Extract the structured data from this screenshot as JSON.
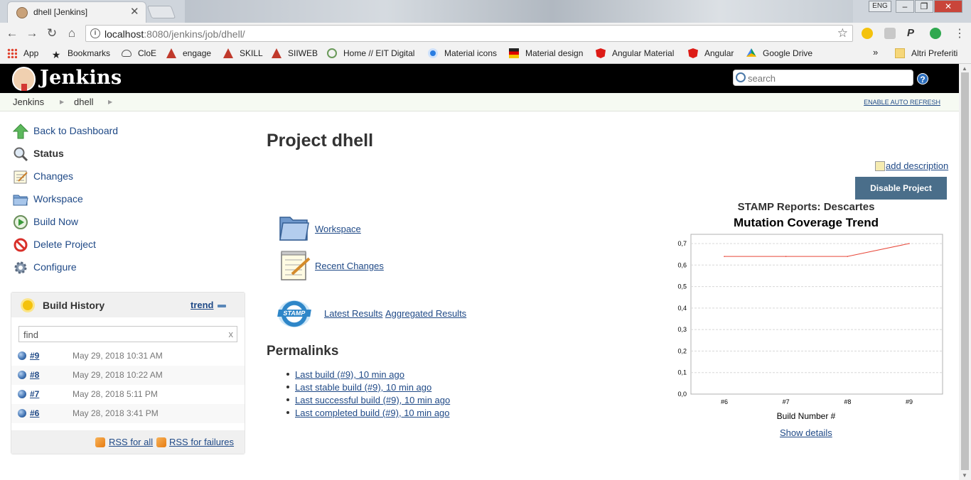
{
  "browser": {
    "tab_title": "dhell [Jenkins]",
    "lang": "ENG",
    "url_host": "localhost",
    "url_rest": ":8080/jenkins/job/dhell/",
    "bookmarks": [
      "App",
      "Bookmarks",
      "CloE",
      "engage",
      "SKILL",
      "SIIWEB",
      "Home // EIT Digital",
      "Material icons",
      "Material design",
      "Angular Material",
      "Angular",
      "Google Drive"
    ],
    "bookmarks_overflow": "»",
    "other_bookmarks": "Altri Preferiti"
  },
  "header": {
    "title": "Jenkins",
    "search_placeholder": "search",
    "help": "?"
  },
  "breadcrumbs": [
    "Jenkins",
    "dhell"
  ],
  "auto_refresh": "ENABLE AUTO REFRESH",
  "sidebar": {
    "tasks": [
      "Back to Dashboard",
      "Status",
      "Changes",
      "Workspace",
      "Build Now",
      "Delete Project",
      "Configure"
    ]
  },
  "build_history": {
    "title": "Build History",
    "trend": "trend",
    "find_value": "find",
    "clear": "x",
    "builds": [
      {
        "number": "#9",
        "date": "May 29, 2018 10:31 AM"
      },
      {
        "number": "#8",
        "date": "May 29, 2018 10:22 AM"
      },
      {
        "number": "#7",
        "date": "May 28, 2018 5:11 PM"
      },
      {
        "number": "#6",
        "date": "May 28, 2018 3:41 PM"
      }
    ],
    "rss_all": "RSS for all",
    "rss_failures": "RSS for failures"
  },
  "main": {
    "title": "Project dhell",
    "add_description": "add description",
    "disable_button": "Disable Project",
    "workspace_link": "Workspace",
    "recent_changes_link": "Recent Changes",
    "stamp_icon_text": "STAMP",
    "latest_results": "Latest Results",
    "aggregated_results": "Aggregated Results",
    "permalinks_title": "Permalinks",
    "permalinks": [
      "Last build (#9), 10 min ago",
      "Last stable build (#9), 10 min ago",
      "Last successful build (#9), 10 min ago",
      "Last completed build (#9), 10 min ago"
    ],
    "show_details": "Show details"
  },
  "chart_data": {
    "type": "line",
    "title": "STAMP Reports: Descartes",
    "subtitle": "Mutation Coverage Trend",
    "xlabel": "Build Number #",
    "ylabel": "",
    "categories": [
      "#6",
      "#7",
      "#8",
      "#9"
    ],
    "values": [
      0.64,
      0.64,
      0.64,
      0.7
    ],
    "ylim": [
      0.0,
      0.7
    ],
    "yticks": [
      "0,0",
      "0,1",
      "0,2",
      "0,3",
      "0,4",
      "0,5",
      "0,6",
      "0,7"
    ],
    "grid": true,
    "line_color": "#e8483a"
  }
}
